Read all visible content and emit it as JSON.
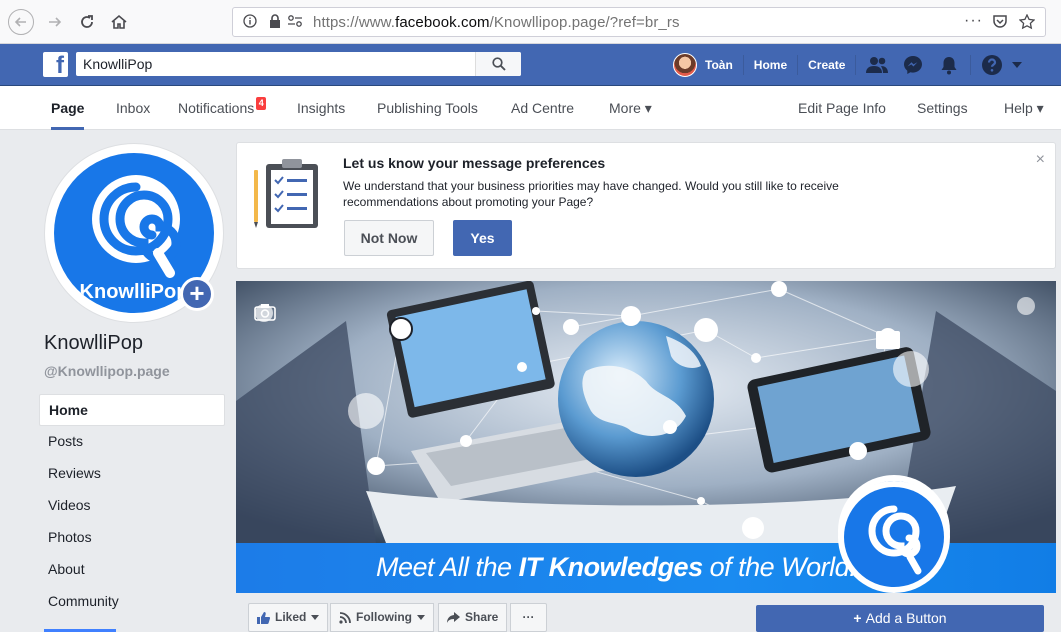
{
  "browser": {
    "url_prefix": "https://www.",
    "url_domain": "facebook.com",
    "url_path": "/Knowllipop.page/?ref=br_rs",
    "menu_icon": "···"
  },
  "fb_header": {
    "logo": "f",
    "search_value": "KnowlliPop",
    "user_name": "Toàn",
    "home_label": "Home",
    "create_label": "Create"
  },
  "page_tabs": {
    "page": "Page",
    "inbox": "Inbox",
    "notifications": "Notifications",
    "notifications_count": "4",
    "insights": "Insights",
    "publishing_tools": "Publishing Tools",
    "ad_centre": "Ad Centre",
    "more": "More ▾",
    "edit_page_info": "Edit Page Info",
    "settings": "Settings",
    "help": "Help ▾"
  },
  "profile": {
    "logo_text": "KnowlliPop",
    "name": "KnowlliPop",
    "handle": "@Knowllipop.page"
  },
  "side_nav": [
    "Home",
    "Posts",
    "Reviews",
    "Videos",
    "Photos",
    "About",
    "Community"
  ],
  "pref_card": {
    "title": "Let us know your message preferences",
    "description": "We understand that your business priorities may have changed. Would you still like to receive recommendations about promoting your Page?",
    "not_now": "Not Now",
    "yes": "Yes",
    "close": "×"
  },
  "cover": {
    "tagline_pre": "Meet All the ",
    "tagline_bold": "IT Knowledges",
    "tagline_post": " of the World!"
  },
  "actions": {
    "liked": "Liked",
    "following": "Following",
    "share": "Share",
    "more": "···",
    "add_button": "Add a Button"
  },
  "colors": {
    "fb_blue": "#4267b2",
    "brand_blue": "#1877e8",
    "badge_red": "#fa3e3e"
  }
}
